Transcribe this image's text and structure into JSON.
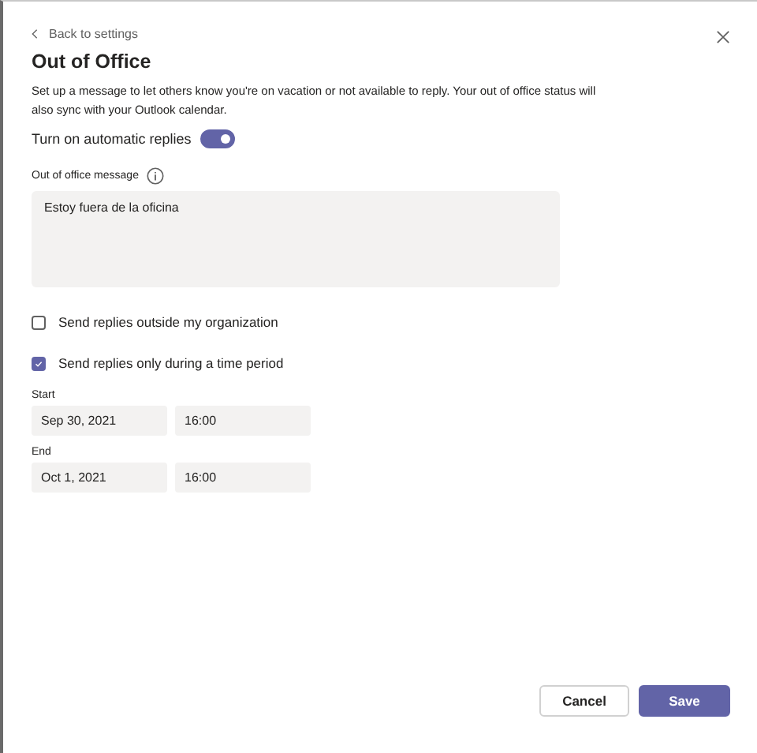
{
  "back_link": "Back to settings",
  "title": "Out of Office",
  "description": "Set up a message to let others know you're on vacation or not available to reply. Your out of office status will also sync with your Outlook calendar.",
  "auto_reply_toggle": {
    "label": "Turn on automatic replies",
    "on": true
  },
  "message": {
    "label": "Out of office message",
    "value": "Estoy fuera de la oficina"
  },
  "options": [
    {
      "label": "Send replies outside my organization",
      "checked": false
    },
    {
      "label": "Send replies only during a time period",
      "checked": true
    }
  ],
  "periods": [
    {
      "label": "Start",
      "date": "Sep 30, 2021",
      "time": "16:00"
    },
    {
      "label": "End",
      "date": "Oct 1, 2021",
      "time": "16:00"
    }
  ],
  "buttons": [
    {
      "label": "Cancel",
      "kind": "secondary"
    },
    {
      "label": "Save",
      "kind": "primary"
    }
  ]
}
